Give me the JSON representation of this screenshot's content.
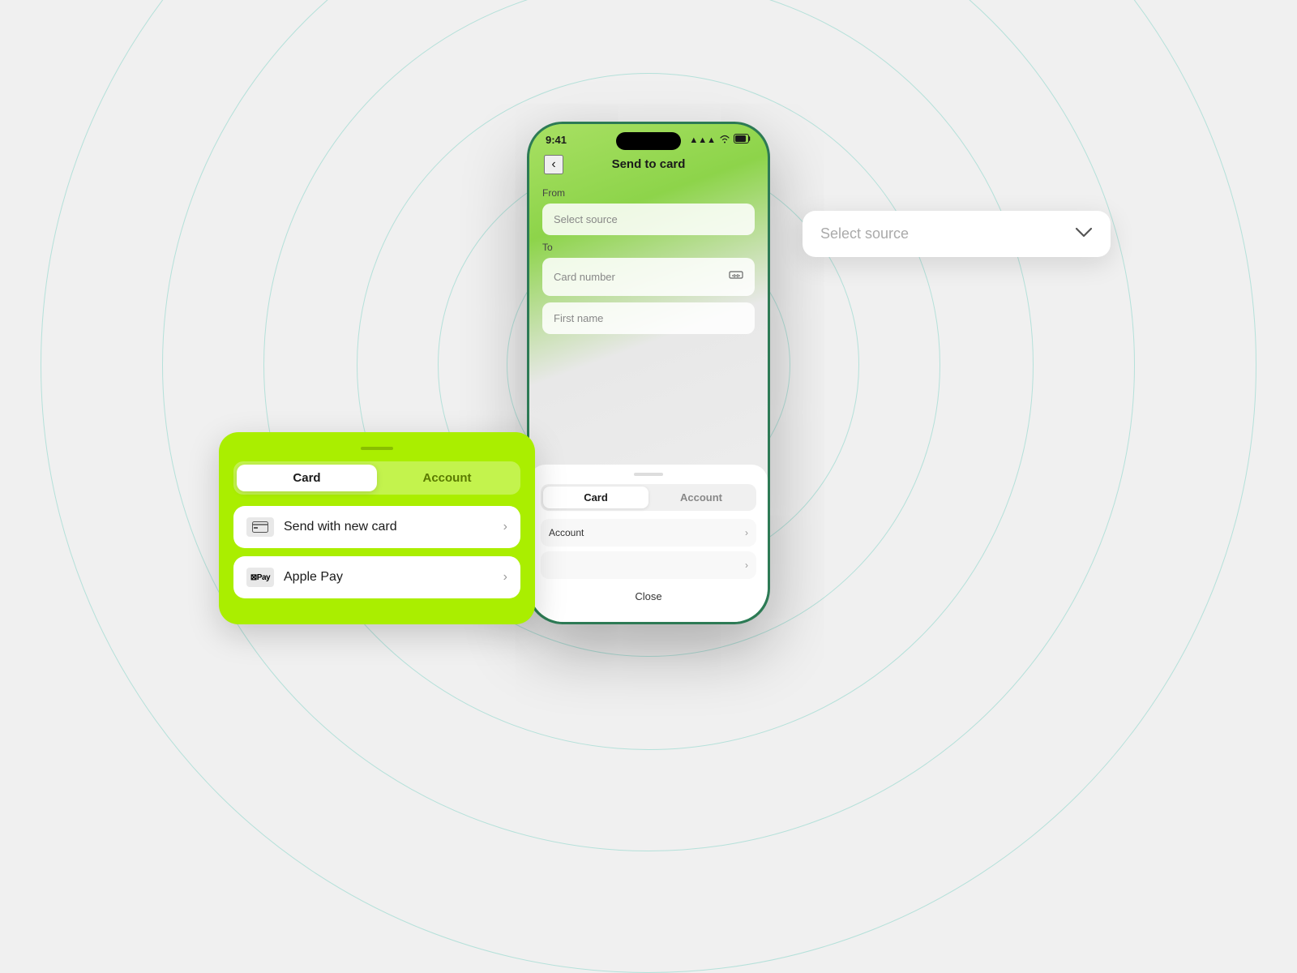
{
  "background": {
    "circle_color": "rgba(0, 180, 150, 0.2)"
  },
  "phone": {
    "status_bar": {
      "time": "9:41",
      "signal": "▲▲▲",
      "wifi": "wifi",
      "battery": "70"
    },
    "header": {
      "back_label": "‹",
      "title": "Send to card"
    },
    "form": {
      "from_label": "From",
      "from_placeholder": "Select source",
      "to_label": "To",
      "card_number_placeholder": "Card number",
      "first_name_placeholder": "First name"
    },
    "bottom_sheet": {
      "tab_card": "Card",
      "tab_account": "Account",
      "rows": [
        {
          "label": "Account",
          "has_chevron": true
        },
        {
          "label": "",
          "has_chevron": true
        }
      ],
      "close_label": "Close"
    }
  },
  "select_source_dropdown": {
    "placeholder": "Select source",
    "chevron": "∨"
  },
  "green_card": {
    "tab_card": "Card",
    "tab_account": "Account",
    "rows": [
      {
        "id": "new-card",
        "icon_type": "card",
        "label": "Send with new card",
        "has_chevron": true
      },
      {
        "id": "apple-pay",
        "icon_type": "applepay",
        "label": "Apple Pay",
        "has_chevron": true
      }
    ]
  }
}
